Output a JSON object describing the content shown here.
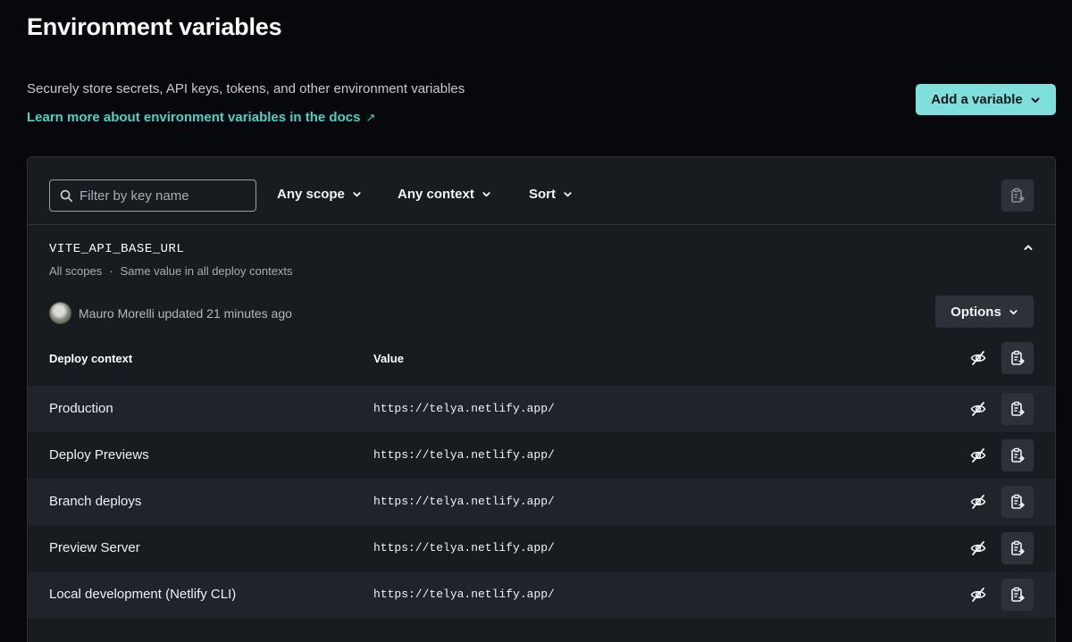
{
  "header": {
    "title": "Environment variables",
    "subtitle": "Securely store secrets, API keys, tokens, and other environment variables",
    "docs_link": "Learn more about environment variables in the docs",
    "docs_arrow": "↗",
    "add_button": "Add a variable"
  },
  "toolbar": {
    "filter_placeholder": "Filter by key name",
    "scope": "Any scope",
    "context": "Any context",
    "sort": "Sort"
  },
  "variable": {
    "key": "VITE_API_BASE_URL",
    "scope": "All scopes",
    "separator": "·",
    "context_summary": "Same value in all deploy contexts",
    "updated_by": "Mauro Morelli updated 21 minutes ago",
    "options_button": "Options",
    "columns": {
      "context": "Deploy context",
      "value": "Value"
    },
    "rows": [
      {
        "context": "Production",
        "value": "https://telya.netlify.app/"
      },
      {
        "context": "Deploy Previews",
        "value": "https://telya.netlify.app/"
      },
      {
        "context": "Branch deploys",
        "value": "https://telya.netlify.app/"
      },
      {
        "context": "Preview Server",
        "value": "https://telya.netlify.app/"
      },
      {
        "context": "Local development (Netlify CLI)",
        "value": "https://telya.netlify.app/"
      }
    ]
  },
  "colors": {
    "accent": "#7fe0db",
    "link": "#4fd1c5",
    "background": "#06080c",
    "panel": "#181b20"
  }
}
